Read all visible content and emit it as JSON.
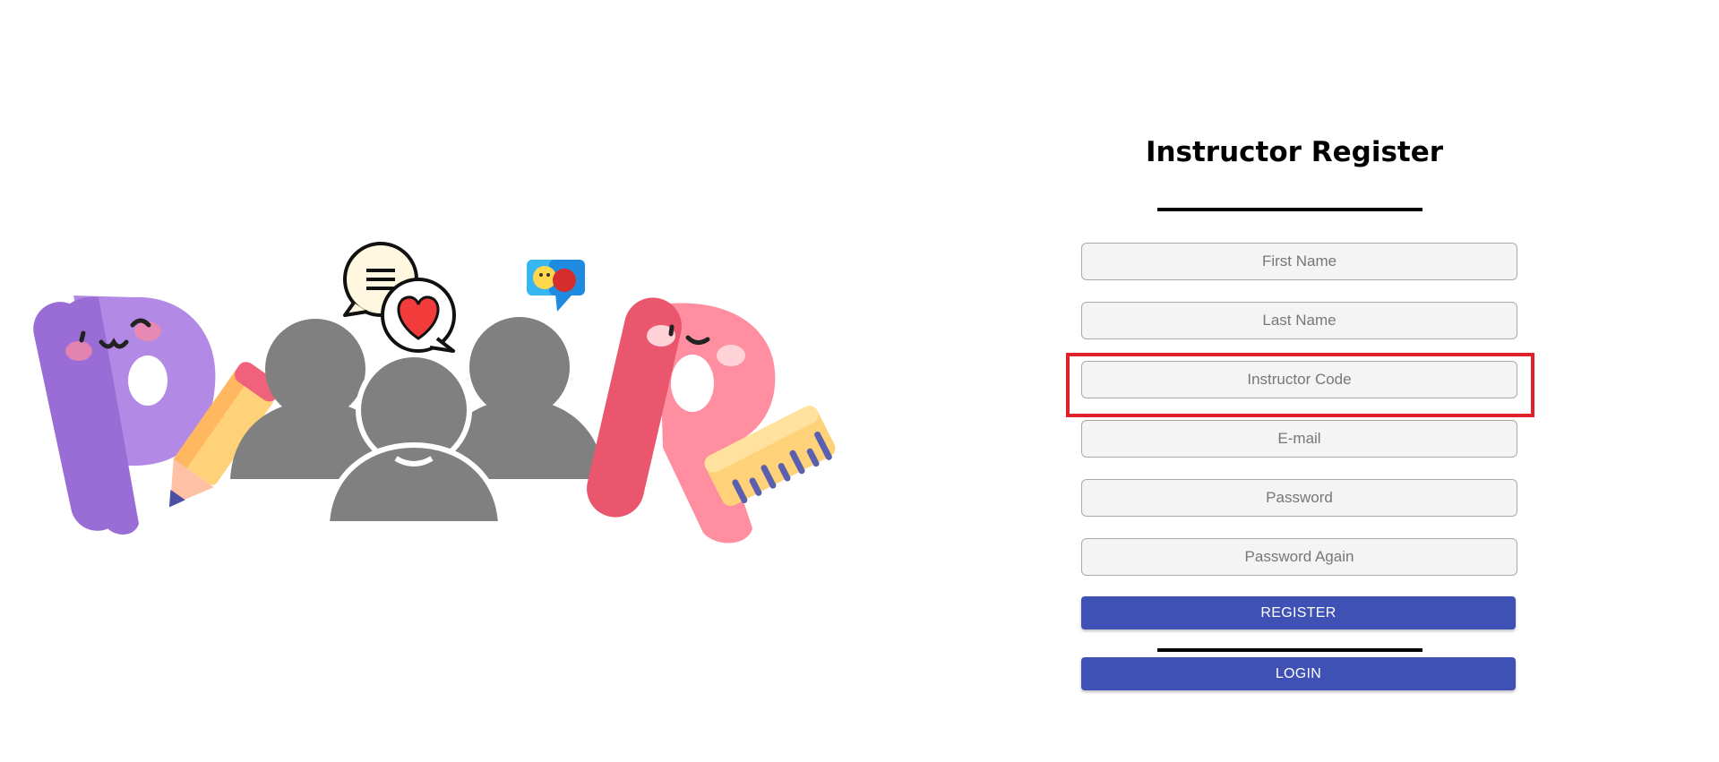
{
  "form": {
    "title": "Instructor Register",
    "fields": [
      {
        "placeholder": "First Name",
        "value": ""
      },
      {
        "placeholder": "Last Name",
        "value": ""
      },
      {
        "placeholder": "Instructor Code",
        "value": ""
      },
      {
        "placeholder": "E-mail",
        "value": ""
      },
      {
        "placeholder": "Password",
        "value": ""
      },
      {
        "placeholder": "Password Again",
        "value": ""
      }
    ],
    "register_label": "REGISTER",
    "login_label": "LOGIN"
  },
  "colors": {
    "button": "#3f51b5",
    "highlight": "#e0202a",
    "field_bg": "#f4f4f4"
  },
  "illustration": {
    "icons": [
      "letter-p-icon",
      "pencil-icon",
      "people-group-icon",
      "chat-bubble-icon",
      "heart-bubble-icon",
      "emoji-masks-icon",
      "letter-r-icon",
      "ruler-icon"
    ]
  }
}
